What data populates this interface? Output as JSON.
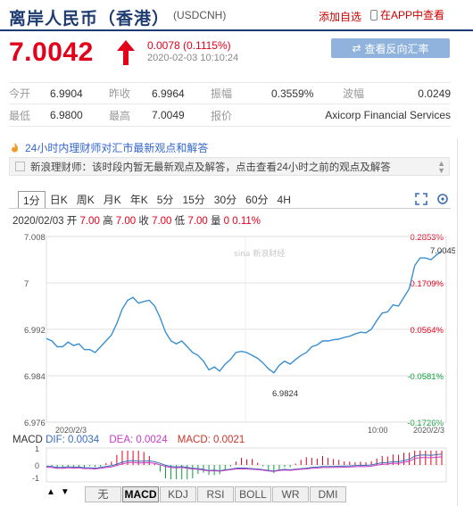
{
  "header": {
    "title": "离岸人民币（香港）",
    "code": "(USDCNH)",
    "fav_label": "添加自选",
    "app_label": "在APP中查看"
  },
  "quote": {
    "price": "7.0042",
    "change": "0.0078 (0.1115%)",
    "time": "2020-02-03 10:10:24",
    "reverse_btn": "查看反向汇率",
    "rows": [
      [
        {
          "label": "今开",
          "value": "6.9904"
        },
        {
          "label": "昨收",
          "value": "6.9964"
        },
        {
          "label": "振幅",
          "value": "0.3559%"
        },
        {
          "label": "波幅",
          "value": "0.0249"
        }
      ],
      [
        {
          "label": "最低",
          "value": "6.9800"
        },
        {
          "label": "最高",
          "value": "7.0049"
        },
        {
          "label": "报价",
          "value": "Axicorp Financial Services"
        }
      ]
    ]
  },
  "news": {
    "headline": "24小时内理财师对汇市最新观点和解答",
    "box_text": "新浪理财师：该时段内暂无最新观点及解答，点击查看24小时之前的观点及解答"
  },
  "tabs": [
    "1分",
    "日K",
    "周K",
    "月K",
    "年K",
    "5分",
    "15分",
    "30分",
    "60分",
    "4H"
  ],
  "active_tab": "1分",
  "ohlc": {
    "date": "2020/02/03",
    "open_label": "开",
    "open": "7.00",
    "high_label": "高",
    "high": "7.00",
    "close_label": "收",
    "close": "7.00",
    "low_label": "低",
    "low": "7.00",
    "vol_label": "量",
    "vol": "0",
    "pct": "0.11%"
  },
  "chart_data": {
    "type": "line",
    "y_ticks": [
      "7.008",
      "7",
      "6.992",
      "6.984",
      "6.976"
    ],
    "pct_ticks": [
      "0.2853%",
      "0.1709%",
      "0.0564%",
      "-0.0581%",
      "-0.1726%"
    ],
    "ylim": [
      6.976,
      7.008
    ],
    "x_labels": [
      "2020/2/3",
      "10:00",
      "2020/2/3"
    ],
    "high_label": "7.0045",
    "low_label": "6.9824",
    "watermark": "sina 新浪财经",
    "values": [
      6.9904,
      6.99,
      6.989,
      6.989,
      6.9898,
      6.9892,
      6.9895,
      6.9885,
      6.9885,
      6.988,
      6.989,
      6.99,
      6.991,
      6.993,
      6.9955,
      6.997,
      6.9975,
      6.9965,
      6.9968,
      6.997,
      6.996,
      6.994,
      6.9915,
      6.99,
      6.9895,
      6.99,
      6.989,
      6.988,
      6.9875,
      6.9865,
      6.985,
      6.9855,
      6.9848,
      6.986,
      6.9868,
      6.988,
      6.9882,
      6.988,
      6.9875,
      6.987,
      6.9862,
      6.9852,
      6.9845,
      6.9858,
      6.9865,
      6.986,
      6.9868,
      6.9875,
      6.988,
      6.989,
      6.9893,
      6.99,
      6.99,
      6.9902,
      6.9903,
      6.9906,
      6.9908,
      6.9912,
      6.9915,
      6.9914,
      6.992,
      6.9935,
      6.9948,
      6.995,
      6.9962,
      6.996,
      6.9975,
      6.999,
      7.003,
      7.0043,
      7.0043,
      7.004,
      7.0048,
      7.0055
    ]
  },
  "macd": {
    "label": "MACD",
    "dif": "DIF: 0.0034",
    "dea": "DEA: 0.0024",
    "macd_val": "MACD: 0.0021",
    "y_ticks": [
      "1",
      "0",
      "-1"
    ]
  },
  "indicator_tabs": [
    "无",
    "MACD",
    "KDJ",
    "RSI",
    "BOLL",
    "WR",
    "DMI"
  ],
  "active_indicator": "MACD",
  "colors": {
    "up": "#e3001b",
    "down": "#0a9e3b",
    "line": "#3a8fd0",
    "brand": "#1f3c70"
  }
}
